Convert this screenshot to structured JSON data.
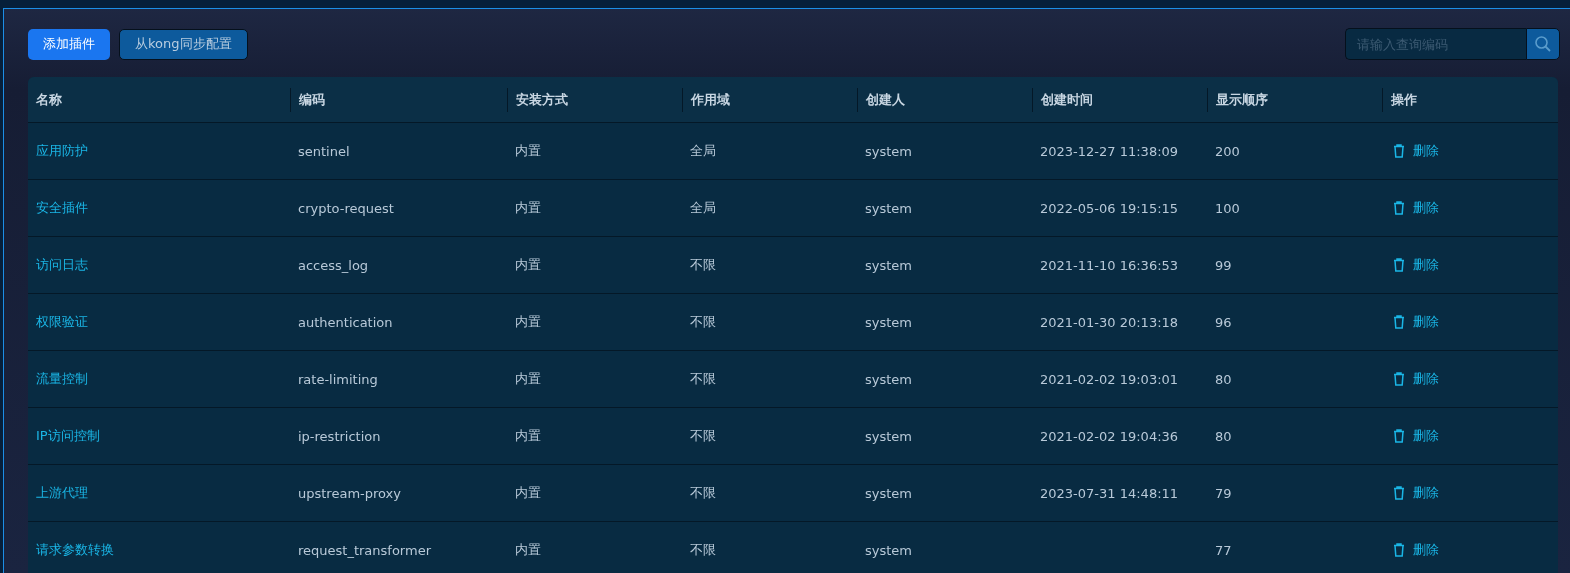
{
  "toolbar": {
    "buttons": [
      {
        "label": "添加插件",
        "kind": "primary"
      },
      {
        "label": "从kong同步配置",
        "kind": "secondary"
      }
    ],
    "search": {
      "placeholder": "请输入查询编码"
    }
  },
  "table": {
    "columns": [
      "名称",
      "编码",
      "安装方式",
      "作用域",
      "创建人",
      "创建时间",
      "显示顺序",
      "操作"
    ],
    "rows": [
      {
        "name": "应用防护",
        "code": "sentinel",
        "install": "内置",
        "scope": "全局",
        "creator": "system",
        "created": "2023-12-27 11:38:09",
        "order": "200",
        "action": "删除"
      },
      {
        "name": "安全插件",
        "code": "crypto-request",
        "install": "内置",
        "scope": "全局",
        "creator": "system",
        "created": "2022-05-06 19:15:15",
        "order": "100",
        "action": "删除"
      },
      {
        "name": "访问日志",
        "code": "access_log",
        "install": "内置",
        "scope": "不限",
        "creator": "system",
        "created": "2021-11-10 16:36:53",
        "order": "99",
        "action": "删除"
      },
      {
        "name": "权限验证",
        "code": "authentication",
        "install": "内置",
        "scope": "不限",
        "creator": "system",
        "created": "2021-01-30 20:13:18",
        "order": "96",
        "action": "删除"
      },
      {
        "name": "流量控制",
        "code": "rate-limiting",
        "install": "内置",
        "scope": "不限",
        "creator": "system",
        "created": "2021-02-02 19:03:01",
        "order": "80",
        "action": "删除"
      },
      {
        "name": "IP访问控制",
        "code": "ip-restriction",
        "install": "内置",
        "scope": "不限",
        "creator": "system",
        "created": "2021-02-02 19:04:36",
        "order": "80",
        "action": "删除"
      },
      {
        "name": "上游代理",
        "code": "upstream-proxy",
        "install": "内置",
        "scope": "不限",
        "creator": "system",
        "created": "2023-07-31 14:48:11",
        "order": "79",
        "action": "删除"
      },
      {
        "name": "请求参数转换",
        "code": "request_transformer",
        "install": "内置",
        "scope": "不限",
        "creator": "system",
        "order": "77",
        "action": "删除"
      }
    ]
  }
}
